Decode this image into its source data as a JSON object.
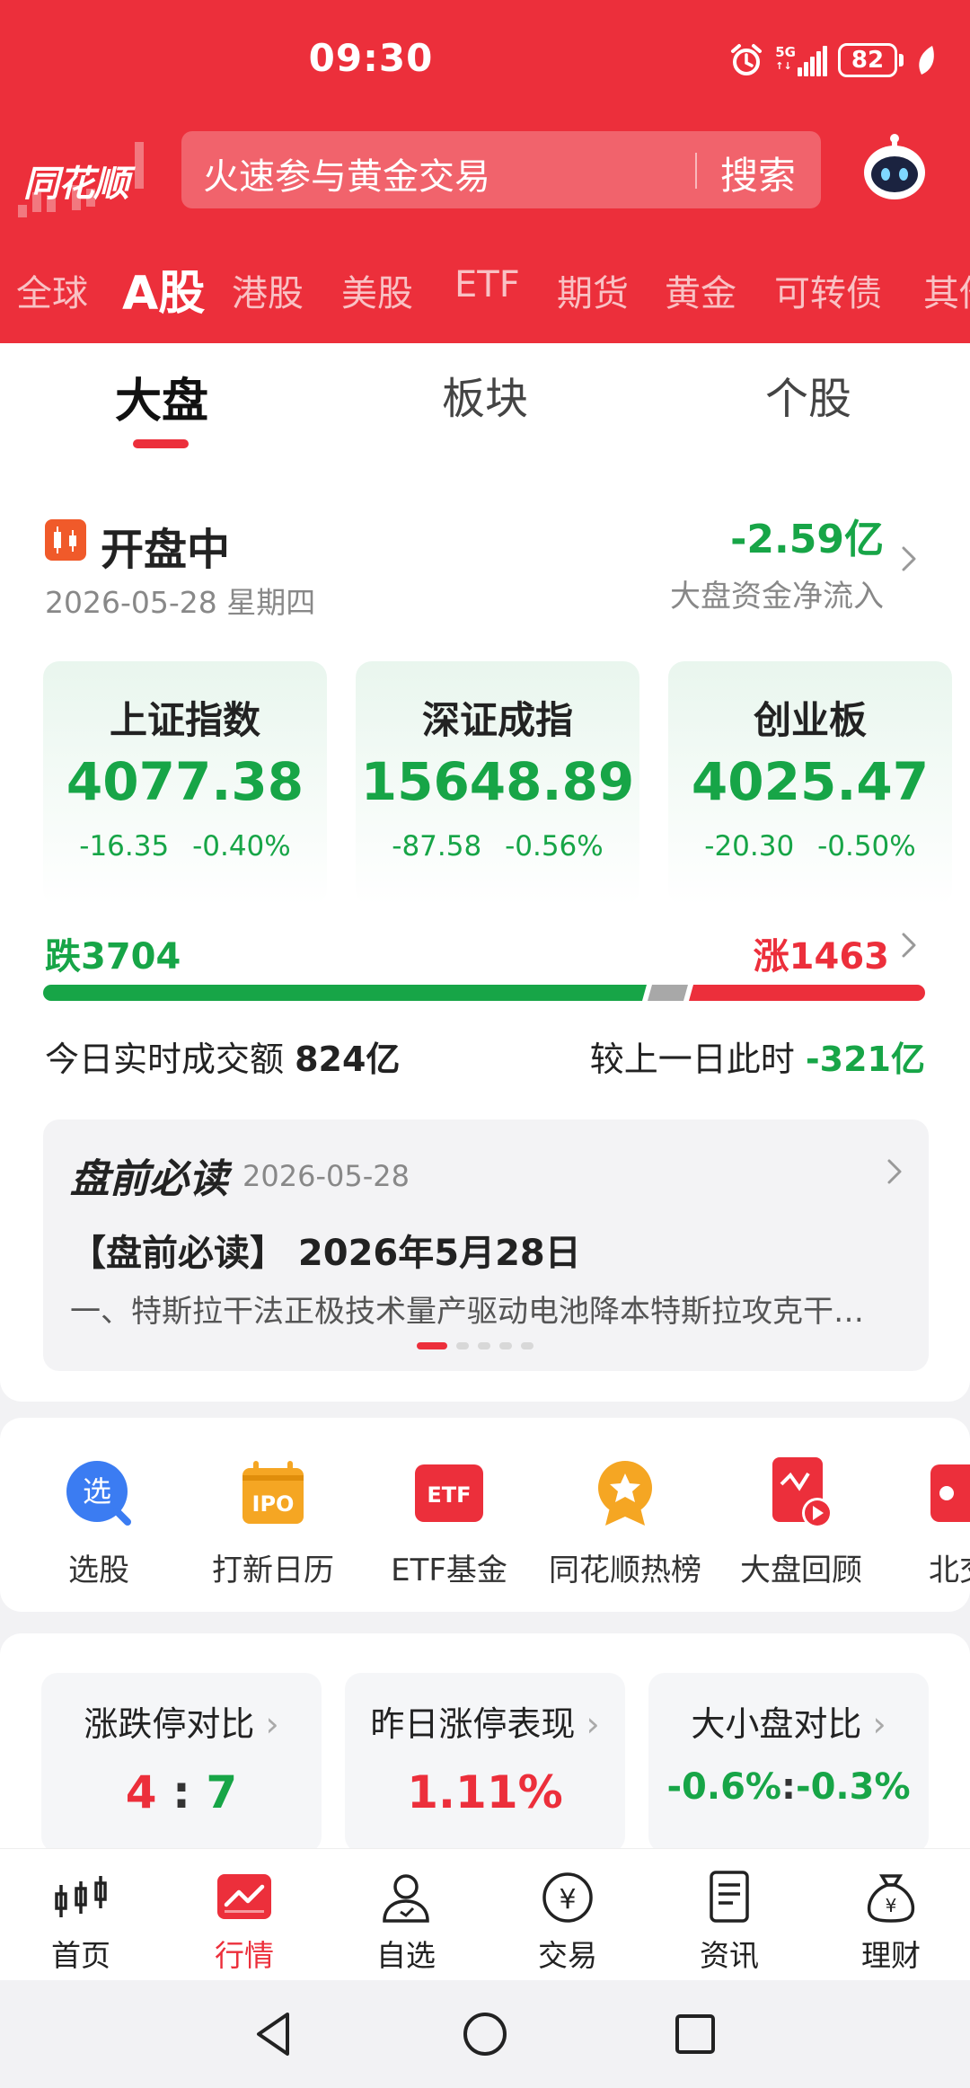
{
  "status_bar": {
    "time": "09:30",
    "network": "5G",
    "battery": "82"
  },
  "header": {
    "logo": "同花顺",
    "search_placeholder": "火速参与黄金交易",
    "search_button": "搜索",
    "market_tabs": [
      "全球",
      "A股",
      "港股",
      "美股",
      "ETF",
      "期货",
      "黄金",
      "可转债",
      "其他"
    ],
    "active_market_tab": "A股"
  },
  "sub_tabs": [
    "大盘",
    "板块",
    "个股"
  ],
  "market_status": {
    "status": "开盘中",
    "date": "2026-05-28 星期四",
    "net_flow_value": "-2.59亿",
    "net_flow_label": "大盘资金净流入"
  },
  "indices": [
    {
      "name": "上证指数",
      "value": "4077.38",
      "change": "-16.35",
      "change_pct": "-0.40%"
    },
    {
      "name": "深证成指",
      "value": "15648.89",
      "change": "-87.58",
      "change_pct": "-0.56%"
    },
    {
      "name": "创业板",
      "value": "4025.47",
      "change": "-20.30",
      "change_pct": "-0.50%"
    }
  ],
  "breadth": {
    "fall": "跌3704",
    "rise": "涨1463",
    "fall_count": 3704,
    "rise_count": 1463
  },
  "volume": {
    "label": "今日实时成交额",
    "value": "824亿",
    "compare_label": "较上一日此时",
    "compare_value": "-321亿"
  },
  "news": {
    "title": "盘前必读",
    "date": "2026-05-28",
    "headline": "【盘前必读】 2026年5月28日",
    "summary": "一、特斯拉干法正极技术量产驱动电池降本特斯拉攻克干…",
    "dots": 5,
    "active_dot": 0
  },
  "tools": [
    {
      "label": "选股",
      "icon": "select-stock-icon"
    },
    {
      "label": "打新日历",
      "icon": "ipo-calendar-icon"
    },
    {
      "label": "ETF基金",
      "icon": "etf-fund-icon"
    },
    {
      "label": "同花顺热榜",
      "icon": "hot-list-icon"
    },
    {
      "label": "大盘回顾",
      "icon": "market-review-icon"
    },
    {
      "label": "北交",
      "icon": "bse-icon"
    }
  ],
  "stats": [
    {
      "title": "涨跌停对比",
      "value_left": "4",
      "sep": ":",
      "value_right": "7"
    },
    {
      "title": "昨日涨停表现",
      "value": "1.11%"
    },
    {
      "title": "大小盘对比",
      "value_left": "-0.6%",
      "sep": ":",
      "value_right": "-0.3%"
    }
  ],
  "bottom_nav": [
    "首页",
    "行情",
    "自选",
    "交易",
    "资讯",
    "理财"
  ],
  "active_nav": "行情",
  "colors": {
    "brand_red": "#ec2f3b",
    "fall_green": "#17a547",
    "neutral_gray": "#a8a8a8"
  }
}
